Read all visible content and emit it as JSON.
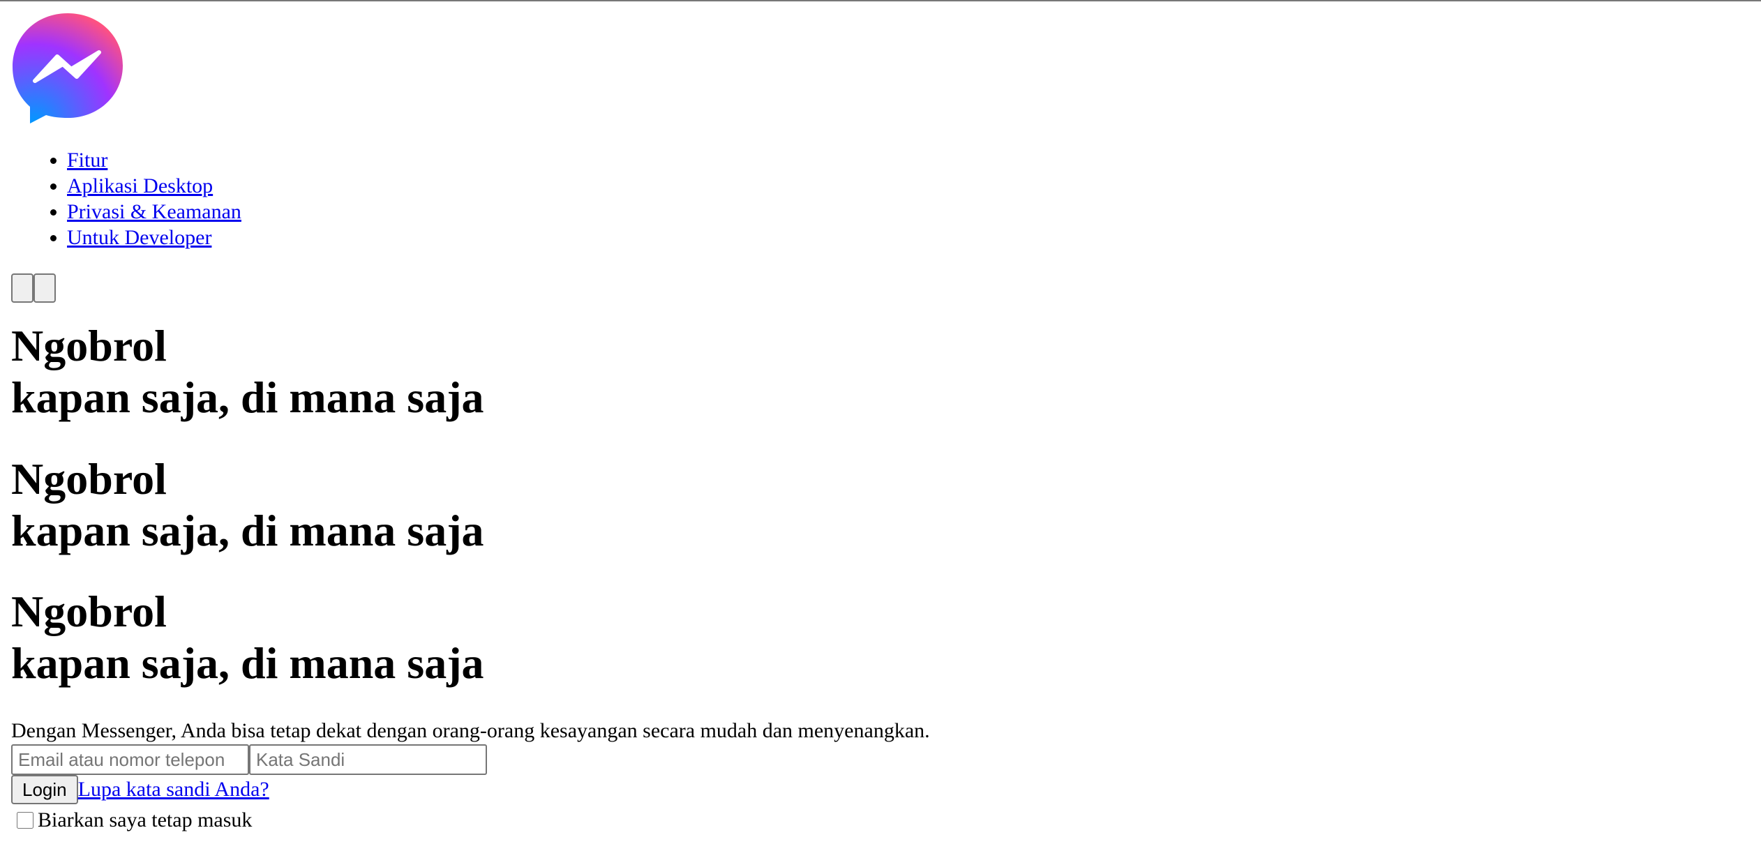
{
  "logo": {
    "icon": "messenger-logo-icon",
    "colors": {
      "gradient_start": "#0099ff",
      "gradient_mid": "#a033ff",
      "gradient_mid2": "#ff5280",
      "gradient_end": "#ff7061",
      "bolt": "#ffffff"
    }
  },
  "nav": {
    "items": [
      {
        "label": "Fitur"
      },
      {
        "label": "Aplikasi Desktop"
      },
      {
        "label": "Privasi & Keamanan"
      },
      {
        "label": "Untuk Developer"
      }
    ]
  },
  "slider": {
    "prev_label": "",
    "next_label": ""
  },
  "heroes": [
    {
      "line1": "Ngobrol",
      "line2": "kapan saja, di mana saja"
    },
    {
      "line1": "Ngobrol",
      "line2": "kapan saja, di mana saja"
    },
    {
      "line1": "Ngobrol",
      "line2": "kapan saja, di mana saja"
    }
  ],
  "description": "Dengan Messenger, Anda bisa tetap dekat dengan orang-orang kesayangan secara mudah dan menyenangkan.",
  "login_form": {
    "email_placeholder": "Email atau nomor telepon",
    "email_value": "",
    "password_placeholder": "Kata Sandi",
    "password_value": "",
    "login_label": "Login",
    "forgot_label": "Lupa kata sandi Anda?",
    "remember_label": "Biarkan saya tetap masuk",
    "remember_checked": false
  },
  "colors": {
    "link": "#0000ee",
    "text": "#000000",
    "background": "#ffffff"
  }
}
